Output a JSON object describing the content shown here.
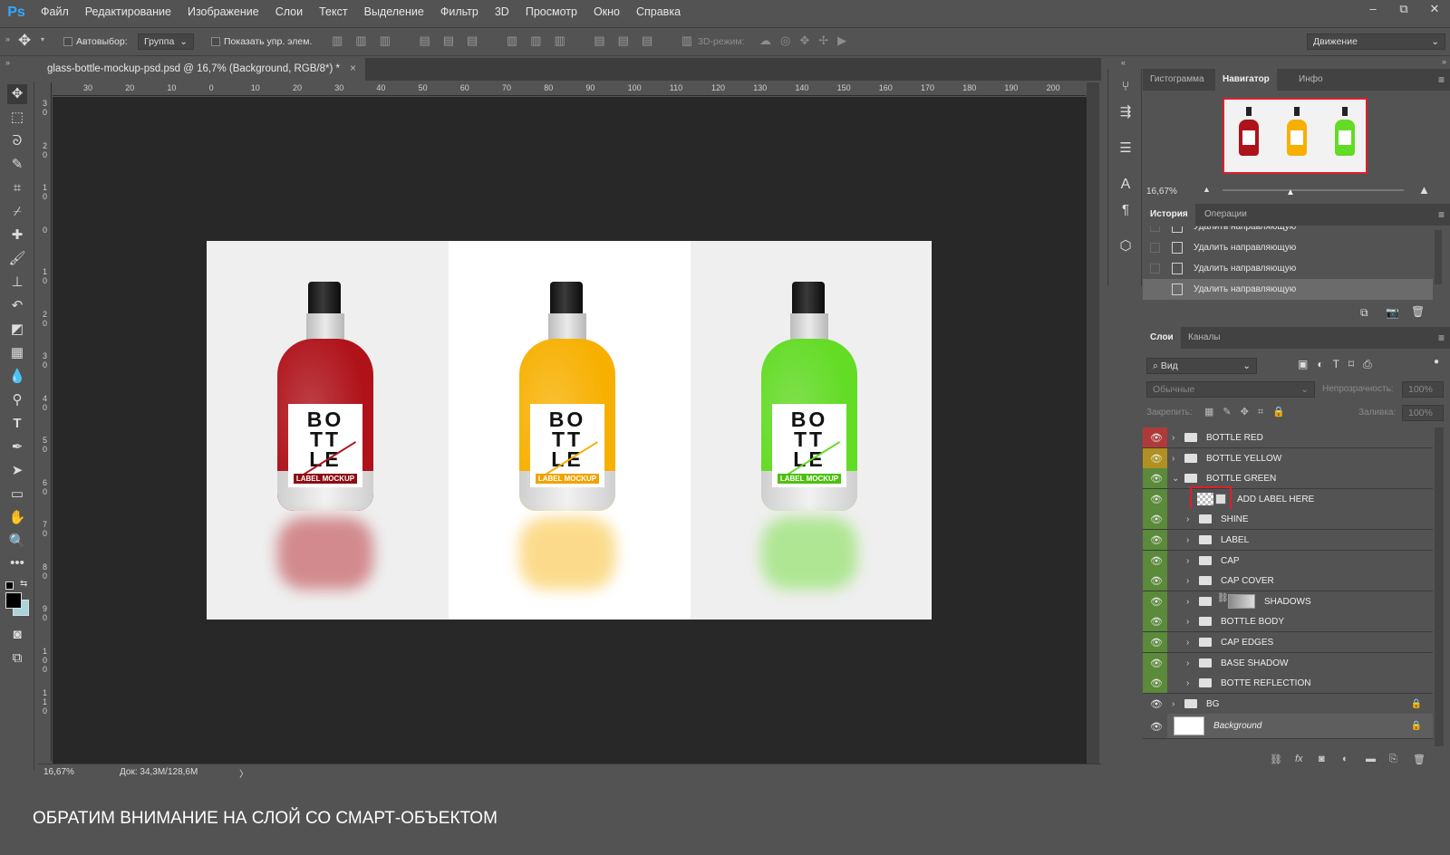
{
  "app": {
    "logo": "Ps"
  },
  "menu": [
    "Файл",
    "Редактирование",
    "Изображение",
    "Слои",
    "Текст",
    "Выделение",
    "Фильтр",
    "3D",
    "Просмотр",
    "Окно",
    "Справка"
  ],
  "window_controls": {
    "minimize": "–",
    "restore": "⧉",
    "close": "✕"
  },
  "options": {
    "autoselect_label": "Автовыбор:",
    "autoselect_value": "Группа",
    "show_controls_label": "Показать упр. элем.",
    "mode_3d_label": "3D-режим:",
    "workspace_value": "Движение"
  },
  "document_tab": {
    "title": "glass-bottle-mockup-psd.psd @ 16,7% (Background, RGB/8*) *",
    "close": "×"
  },
  "ruler_top": [
    "30",
    "20",
    "10",
    "0",
    "10",
    "20",
    "30",
    "40",
    "50",
    "60",
    "70",
    "80",
    "90",
    "100",
    "110",
    "120",
    "130",
    "140",
    "150",
    "160",
    "170",
    "180",
    "190",
    "200"
  ],
  "ruler_left": [
    "3 0",
    "2 0",
    "1 0",
    "0",
    "1 0",
    "2 0",
    "3 0",
    "4 0",
    "5 0",
    "6 0",
    "7 0",
    "8 0",
    "9 0",
    "1 0 0",
    "1 1 0"
  ],
  "canvas": {
    "bottles": [
      {
        "title": "BO TT LE",
        "tag": "LABEL MOCKUP",
        "color": "#b0121a",
        "tag_color": "#8c0d14"
      },
      {
        "title": "BO TT LE",
        "tag": "LABEL MOCKUP",
        "color": "#f7b000",
        "tag_color": "#f0a300"
      },
      {
        "title": "BO TT LE",
        "tag": "LABEL MOCKUP",
        "color": "#62dc24",
        "tag_color": "#4fbf10"
      }
    ]
  },
  "status": {
    "zoom": "16,67%",
    "doc_info": "Док: 34,3M/128,6M",
    "arrow": "〉"
  },
  "navigator": {
    "tabs": [
      "Гистограмма",
      "Навигатор",
      "Инфо"
    ],
    "zoom": "16,67%",
    "slider_position": 0.35
  },
  "history": {
    "tabs": [
      "История",
      "Операции"
    ],
    "items": [
      "Удалить направляющую",
      "Удалить направляющую",
      "Удалить направляющую",
      "Удалить направляющую"
    ]
  },
  "layers": {
    "tabs": [
      "Слои",
      "Каналы"
    ],
    "filter_label": "Вид",
    "blend_mode": "Обычные",
    "opacity_label": "Непрозрачность:",
    "opacity_value": "100%",
    "lock_label": "Закрепить:",
    "fill_label": "Заливка:",
    "fill_value": "100%",
    "rows": [
      {
        "name": "BOTTLE RED",
        "type": "group",
        "indent": 0,
        "eye_color": "#b03a3a",
        "lock": "",
        "arrow": "›"
      },
      {
        "name": "BOTTLE YELLOW",
        "type": "group",
        "indent": 0,
        "eye_color": "#b09020",
        "lock": "",
        "arrow": "›"
      },
      {
        "name": "BOTTLE GREEN",
        "type": "group",
        "indent": 0,
        "eye_color": "#5a8a3a",
        "lock": "",
        "arrow": "⌄"
      },
      {
        "name": "ADD LABEL HERE",
        "type": "smart",
        "indent": 1,
        "eye_color": "#5a8a3a",
        "lock": "",
        "arrow": ""
      },
      {
        "name": "SHINE",
        "type": "group",
        "indent": 1,
        "eye_color": "#5a8a3a",
        "lock": "",
        "arrow": "›"
      },
      {
        "name": "LABEL",
        "type": "group",
        "indent": 1,
        "eye_color": "#5a8a3a",
        "lock": "",
        "arrow": "›"
      },
      {
        "name": "CAP",
        "type": "group",
        "indent": 1,
        "eye_color": "#5a8a3a",
        "lock": "",
        "arrow": "›"
      },
      {
        "name": "CAP COVER",
        "type": "group",
        "indent": 1,
        "eye_color": "#5a8a3a",
        "lock": "",
        "arrow": "›"
      },
      {
        "name": "SHADOWS",
        "type": "group-mask",
        "indent": 1,
        "eye_color": "#5a8a3a",
        "lock": "",
        "arrow": "›"
      },
      {
        "name": "BOTTLE BODY",
        "type": "group",
        "indent": 1,
        "eye_color": "#5a8a3a",
        "lock": "",
        "arrow": "›"
      },
      {
        "name": "CAP EDGES",
        "type": "group",
        "indent": 1,
        "eye_color": "#5a8a3a",
        "lock": "",
        "arrow": "›"
      },
      {
        "name": "BASE SHADOW",
        "type": "group",
        "indent": 1,
        "eye_color": "#5a8a3a",
        "lock": "",
        "arrow": "›"
      },
      {
        "name": "BOTTE REFLECTION",
        "type": "group",
        "indent": 1,
        "eye_color": "#5a8a3a",
        "lock": "",
        "arrow": "›"
      },
      {
        "name": "BG",
        "type": "group",
        "indent": 0,
        "eye_color": "#535353",
        "lock": "🔒",
        "arrow": "›"
      },
      {
        "name": "Background",
        "type": "background",
        "indent": 0,
        "eye_color": "#535353",
        "lock": "🔒",
        "arrow": ""
      }
    ]
  },
  "caption": "ОБРАТИМ ВНИМАНИЕ НА СЛОЙ СО СМАРТ-ОБЪЕКТОМ"
}
